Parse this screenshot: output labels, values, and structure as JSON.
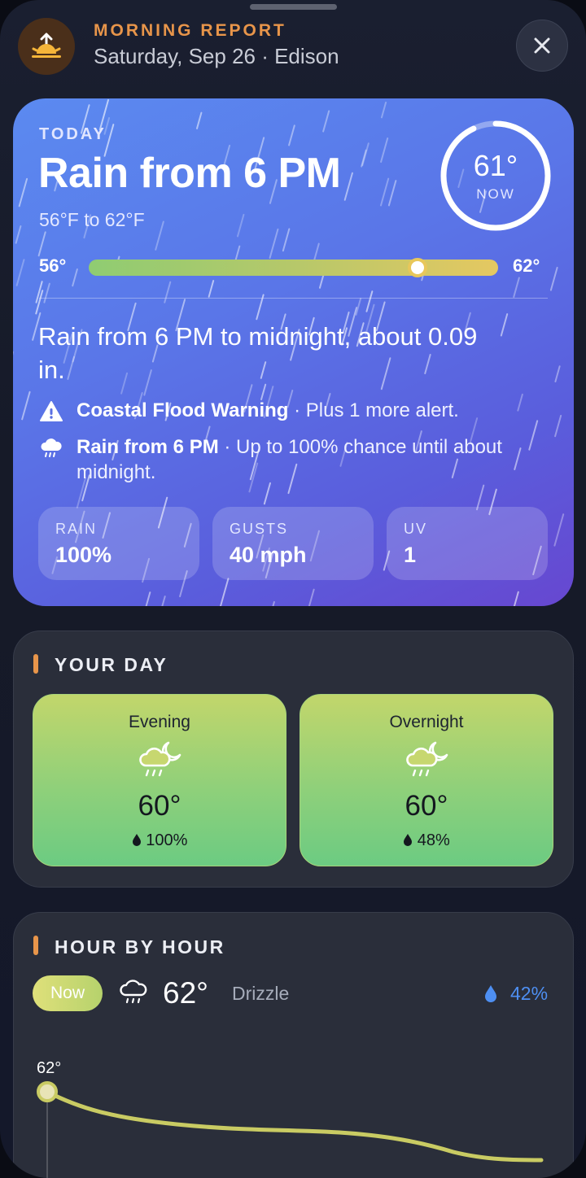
{
  "header": {
    "title": "MORNING REPORT",
    "subtitle": "Saturday, Sep 26 · Edison",
    "icon": "sunrise-icon",
    "close_icon": "close-icon"
  },
  "today": {
    "label": "TODAY",
    "headline": "Rain from 6 PM",
    "range_text": "56°F to 62°F",
    "current_temp": "61°",
    "current_label": "NOW",
    "low": "56°",
    "high": "62°",
    "current_position_fraction": 0.83,
    "summary": "Rain from 6 PM to midnight, about 0.09 in.",
    "alerts": [
      {
        "icon": "warning-icon",
        "title": "Coastal Flood Warning",
        "detail": " · Plus 1 more alert."
      },
      {
        "icon": "rain-cloud-icon",
        "title": "Rain from 6 PM",
        "detail": " · Up to 100% chance until about midnight."
      }
    ],
    "stats": [
      {
        "label": "RAIN",
        "value": "100%"
      },
      {
        "label": "GUSTS",
        "value": "40 mph"
      },
      {
        "label": "UV",
        "value": "1"
      }
    ]
  },
  "your_day": {
    "title": "YOUR DAY",
    "periods": [
      {
        "name": "Evening",
        "icon": "rainy-night-icon",
        "temp": "60°",
        "precip": "100%"
      },
      {
        "name": "Overnight",
        "icon": "rainy-night-icon",
        "temp": "60°",
        "precip": "48%"
      }
    ]
  },
  "hour_by_hour": {
    "title": "HOUR BY HOUR",
    "now_label": "Now",
    "temp": "62°",
    "condition": "Drizzle",
    "precip": "42%",
    "graph_start_label": "62°"
  },
  "colors": {
    "accent_orange": "#e8954a",
    "rain_blue": "#4e8ff2",
    "hero_gradient_start": "#5b8af0",
    "hero_gradient_end": "#6747d0"
  }
}
